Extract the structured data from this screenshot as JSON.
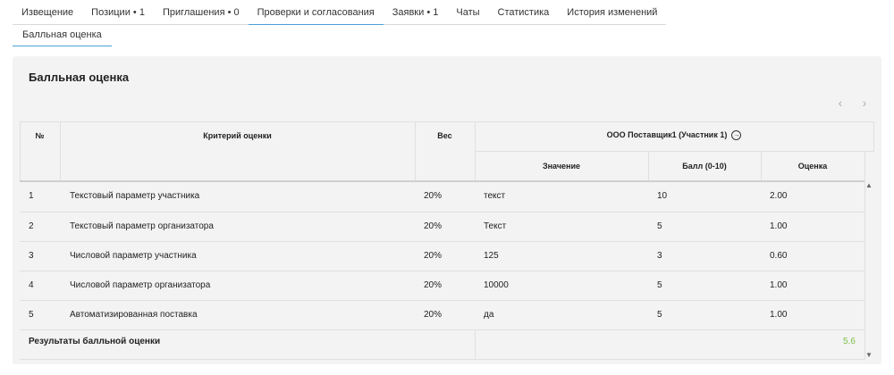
{
  "tabs": [
    {
      "label": "Извещение"
    },
    {
      "label": "Позиции • 1"
    },
    {
      "label": "Приглашения • 0"
    },
    {
      "label": "Проверки и согласования"
    },
    {
      "label": "Заявки • 1"
    },
    {
      "label": "Чаты"
    },
    {
      "label": "Статистика"
    },
    {
      "label": "История изменений"
    }
  ],
  "subtabs": [
    {
      "label": "Балльная оценка"
    }
  ],
  "panel": {
    "title": "Балльная оценка"
  },
  "table": {
    "headers": {
      "num": "№",
      "criterion": "Критерий оценки",
      "weight": "Вес",
      "participant": "ООО Поставщик1 (Участник 1)",
      "value": "Значение",
      "score": "Балл (0-10)",
      "grade": "Оценка"
    },
    "rows": [
      {
        "num": "1",
        "criterion": "Текстовый параметр участника",
        "weight": "20%",
        "value": "текст",
        "score": "10",
        "grade": "2.00"
      },
      {
        "num": "2",
        "criterion": "Текстовый параметр организатора",
        "weight": "20%",
        "value": "Текст",
        "score": "5",
        "grade": "1.00"
      },
      {
        "num": "3",
        "criterion": "Числовой параметр участника",
        "weight": "20%",
        "value": "125",
        "score": "3",
        "grade": "0.60"
      },
      {
        "num": "4",
        "criterion": "Числовой параметр организатора",
        "weight": "20%",
        "value": "10000",
        "score": "5",
        "grade": "1.00"
      },
      {
        "num": "5",
        "criterion": "Автоматизированная поставка",
        "weight": "20%",
        "value": "да",
        "score": "5",
        "grade": "1.00"
      }
    ],
    "footer": {
      "label": "Результаты балльной оценки",
      "total": "5.6"
    }
  },
  "icons": {
    "prev": "chevron-left-icon",
    "next": "chevron-right-icon",
    "participant_link": "circle-arrow-right-icon",
    "scroll_up": "triangle-up-icon",
    "scroll_down": "triangle-down-icon"
  },
  "colors": {
    "accent": "#4a9fd8",
    "total": "#7fbf4a",
    "panel_bg": "#f3f3f3"
  }
}
